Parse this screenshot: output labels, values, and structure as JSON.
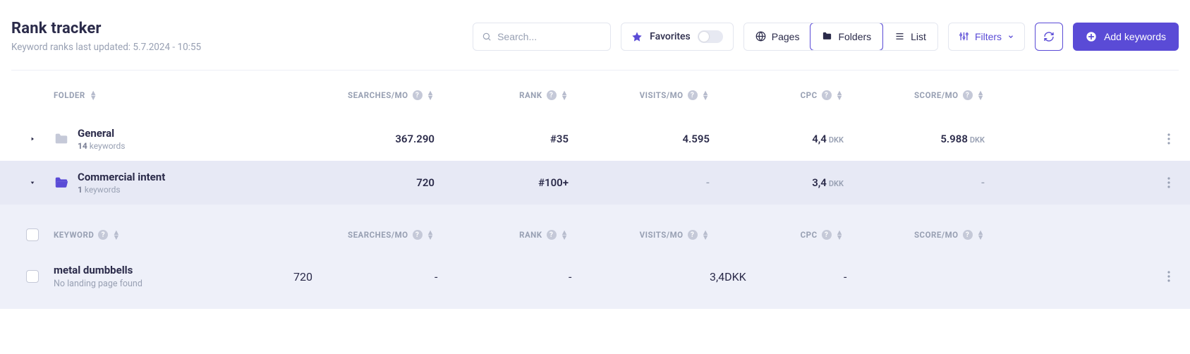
{
  "header": {
    "title": "Rank tracker",
    "subtitle": "Keyword ranks last updated: 5.7.2024 - 10:55"
  },
  "toolbar": {
    "search_placeholder": "Search...",
    "favorites_label": "Favorites",
    "pages_label": "Pages",
    "folders_label": "Folders",
    "list_label": "List",
    "filters_label": "Filters",
    "add_label": "Add keywords"
  },
  "columns": {
    "folder": "FOLDER",
    "searches": "SEARCHES/MO",
    "rank": "RANK",
    "visits": "VISITS/MO",
    "cpc": "CPC",
    "score": "SCORE/MO"
  },
  "currency": "DKK",
  "folders": [
    {
      "name": "General",
      "count": "14",
      "count_suffix": "keywords",
      "searches": "367.290",
      "rank": "#35",
      "visits": "4.595",
      "cpc": "4,4",
      "score": "5.988",
      "expanded": false
    },
    {
      "name": "Commercial intent",
      "count": "1",
      "count_suffix": "keywords",
      "searches": "720",
      "rank": "#100+",
      "visits": "-",
      "cpc": "3,4",
      "score": "-",
      "expanded": true
    }
  ],
  "sub_columns": {
    "keyword": "KEYWORD",
    "searches": "SEARCHES/MO",
    "rank": "RANK",
    "visits": "VISITS/MO",
    "cpc": "CPC",
    "score": "SCORE/MO"
  },
  "keywords": [
    {
      "name": "metal dumbbells",
      "meta": "No landing page found",
      "searches": "720",
      "rank": "-",
      "visits": "-",
      "cpc": "3,4",
      "score": "-"
    }
  ]
}
